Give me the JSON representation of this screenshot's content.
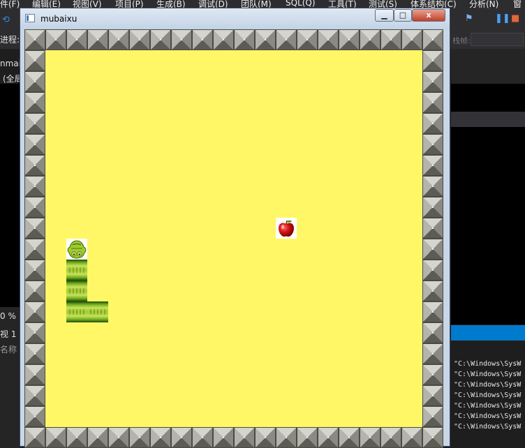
{
  "ide": {
    "menu": [
      "件(F)",
      "编辑(E)",
      "视图(V)",
      "项目(P)",
      "生成(B)",
      "调试(D)",
      "团队(M)",
      "SQL(Q)",
      "工具(T)",
      "测试(S)",
      "体系结构(C)",
      "分析(N)",
      "窗"
    ],
    "process_label": "进程:",
    "stack_label": "栈帧:",
    "left_text_1": "nmai",
    "left_text_2": "(全局",
    "zoom": "0 %",
    "view_label": "视 1",
    "name_label": "名称",
    "output_lines": [
      "\"C:\\Windows\\SysW",
      "\"C:\\Windows\\SysW",
      "\"C:\\Windows\\SysW",
      "\"C:\\Windows\\SysW",
      "\"C:\\Windows\\SysW",
      "\"C:\\Windows\\SysW",
      "\"C:\\Windows\\SysW"
    ]
  },
  "window": {
    "title": "mubaixu",
    "minimize_glyph": "▁",
    "maximize_glyph": "□",
    "close_glyph": "x"
  },
  "game": {
    "grid_cols": 20,
    "grid_rows": 20,
    "wall": "border",
    "snake": [
      {
        "col": 2,
        "row": 10,
        "part": "head",
        "facing": "up"
      },
      {
        "col": 2,
        "row": 11,
        "part": "body"
      },
      {
        "col": 2,
        "row": 12,
        "part": "body"
      },
      {
        "col": 2,
        "row": 13,
        "part": "body"
      },
      {
        "col": 3,
        "row": 13,
        "part": "tail"
      }
    ],
    "food": {
      "col": 12,
      "row": 9,
      "type": "apple-icon"
    },
    "colors": {
      "playfield": "#fff766",
      "wall": "#8a8a82",
      "snake": "#9fcb2e",
      "apple": "#d01010"
    }
  }
}
